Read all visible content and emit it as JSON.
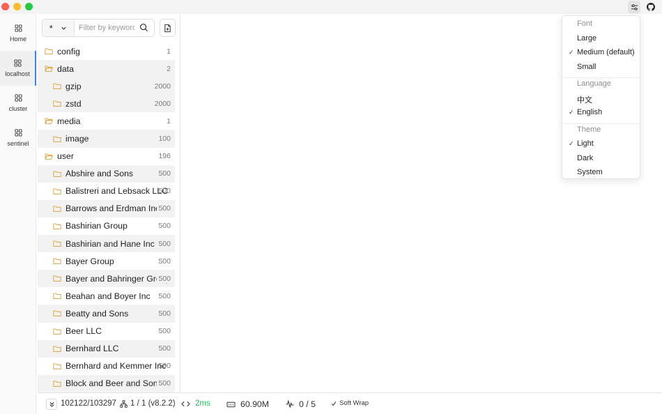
{
  "window": {
    "controls": [
      "close",
      "minimize",
      "maximize"
    ],
    "actions": [
      {
        "name": "settings-icon"
      },
      {
        "name": "github-icon"
      }
    ]
  },
  "nav": {
    "items": [
      {
        "label": "Home",
        "icon": "grid-icon",
        "active": false
      },
      {
        "label": "localhost",
        "icon": "grid-icon",
        "active": true
      },
      {
        "label": "cluster",
        "icon": "grid-icon",
        "active": false
      },
      {
        "label": "sentinel",
        "icon": "grid-icon",
        "active": false
      }
    ]
  },
  "filter": {
    "type_value": "*",
    "placeholder": "Filter by keyword"
  },
  "tree": {
    "rows": [
      {
        "name": "config",
        "count": "1",
        "level": 0,
        "open": false
      },
      {
        "name": "data",
        "count": "2",
        "level": 0,
        "open": true
      },
      {
        "name": "gzip",
        "count": "2000",
        "level": 1,
        "open": false
      },
      {
        "name": "zstd",
        "count": "2000",
        "level": 1,
        "open": false
      },
      {
        "name": "media",
        "count": "1",
        "level": 0,
        "open": true
      },
      {
        "name": "image",
        "count": "100",
        "level": 1,
        "open": false
      },
      {
        "name": "user",
        "count": "196",
        "level": 0,
        "open": true
      },
      {
        "name": "Abshire and Sons",
        "count": "500",
        "level": 1,
        "open": false
      },
      {
        "name": "Balistreri and Lebsack LLC",
        "count": "500",
        "level": 1,
        "open": false
      },
      {
        "name": "Barrows and Erdman Inc",
        "count": "500",
        "level": 1,
        "open": false
      },
      {
        "name": "Bashirian Group",
        "count": "500",
        "level": 1,
        "open": false
      },
      {
        "name": "Bashirian and Hane Inc",
        "count": "500",
        "level": 1,
        "open": false
      },
      {
        "name": "Bayer Group",
        "count": "500",
        "level": 1,
        "open": false
      },
      {
        "name": "Bayer and Bahringer Group",
        "count": "500",
        "level": 1,
        "open": false
      },
      {
        "name": "Beahan and Boyer Inc",
        "count": "500",
        "level": 1,
        "open": false
      },
      {
        "name": "Beatty and Sons",
        "count": "500",
        "level": 1,
        "open": false
      },
      {
        "name": "Beer LLC",
        "count": "500",
        "level": 1,
        "open": false
      },
      {
        "name": "Bernhard LLC",
        "count": "500",
        "level": 1,
        "open": false
      },
      {
        "name": "Bernhard and Kemmer Inc",
        "count": "500",
        "level": 1,
        "open": false
      },
      {
        "name": "Block and Beer and Sons",
        "count": "500",
        "level": 1,
        "open": false
      }
    ]
  },
  "status": {
    "keys": "102122/103297",
    "nodes": "1 / 1 (v8.2.2)",
    "latency": "2ms",
    "memory": "60.90M",
    "clients": "0 / 5",
    "soft_wrap": "Soft Wrap",
    "latency_color": "#22c55e"
  },
  "menu": {
    "sections": [
      {
        "title": "Font",
        "options": [
          {
            "label": "Large",
            "checked": false
          },
          {
            "label": "Medium (default)",
            "checked": true
          },
          {
            "label": "Small",
            "checked": false
          }
        ]
      },
      {
        "title": "Language",
        "options": [
          {
            "label": "中文",
            "checked": false
          },
          {
            "label": "English",
            "checked": true
          }
        ]
      },
      {
        "title": "Theme",
        "options": [
          {
            "label": "Light",
            "checked": true
          },
          {
            "label": "Dark",
            "checked": false
          },
          {
            "label": "System",
            "checked": false
          }
        ]
      }
    ]
  },
  "colors": {
    "accent": "#3b82f6",
    "folder": "#d9a441",
    "row_shade": "#f2f2f2"
  }
}
